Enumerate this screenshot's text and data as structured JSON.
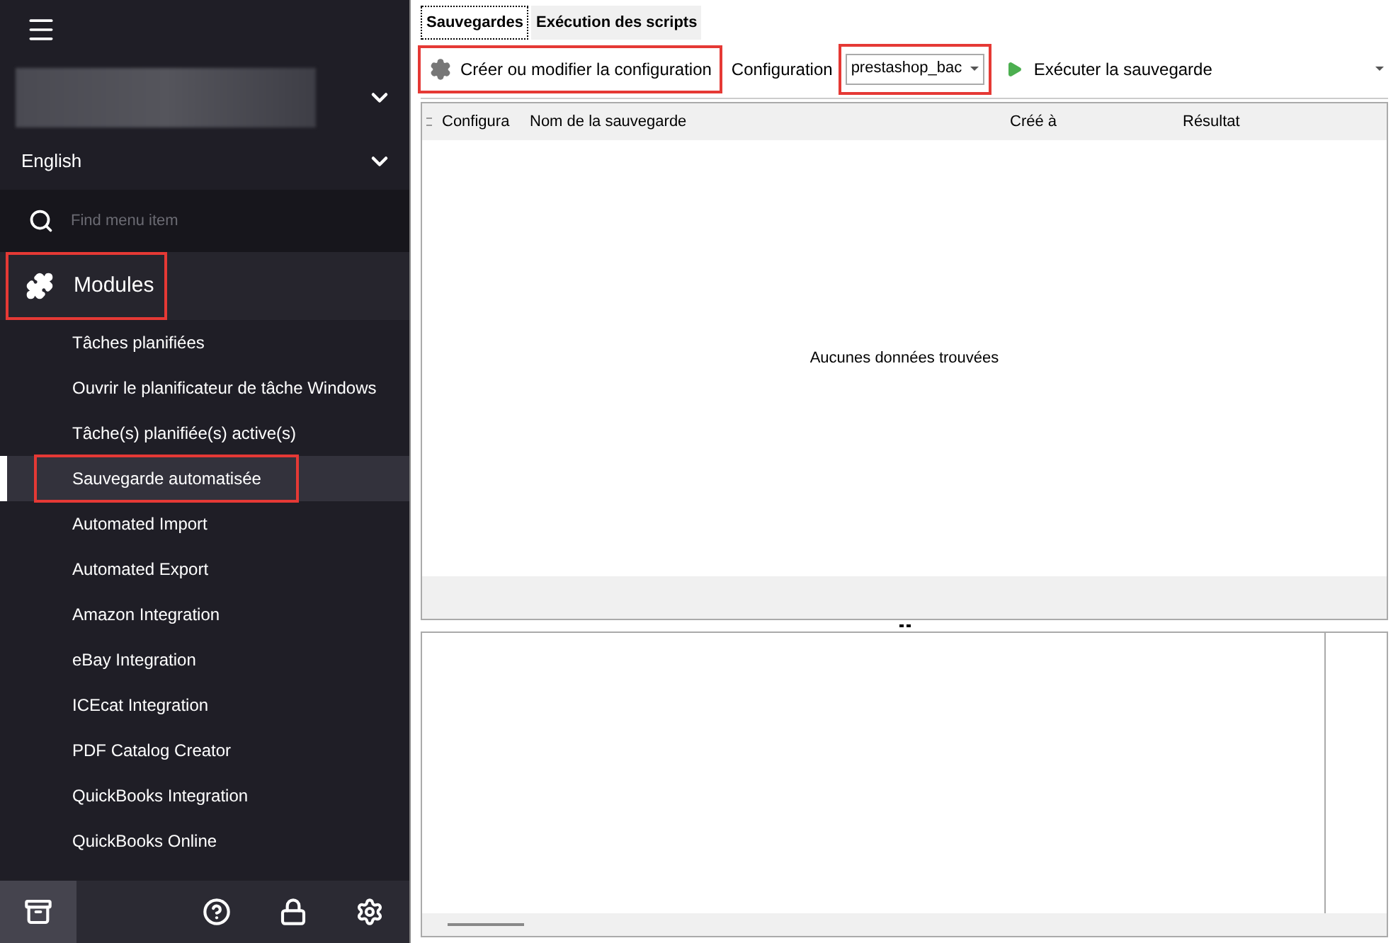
{
  "sidebar": {
    "language": "English",
    "search": {
      "placeholder": "Find menu item"
    },
    "section": {
      "label": "Modules",
      "highlighted": true,
      "expanded": true
    },
    "items": [
      {
        "label": "Tâches planifiées",
        "selected": false,
        "highlighted": false
      },
      {
        "label": "Ouvrir le planificateur de tâche Windows",
        "selected": false,
        "highlighted": false
      },
      {
        "label": "Tâche(s) planifiée(s) active(s)",
        "selected": false,
        "highlighted": false
      },
      {
        "label": "Sauvegarde automatisée",
        "selected": true,
        "highlighted": true
      },
      {
        "label": "Automated Import",
        "selected": false,
        "highlighted": false
      },
      {
        "label": "Automated Export",
        "selected": false,
        "highlighted": false
      },
      {
        "label": "Amazon Integration",
        "selected": false,
        "highlighted": false
      },
      {
        "label": "eBay Integration",
        "selected": false,
        "highlighted": false
      },
      {
        "label": "ICEcat Integration",
        "selected": false,
        "highlighted": false
      },
      {
        "label": "PDF Catalog Creator",
        "selected": false,
        "highlighted": false
      },
      {
        "label": "QuickBooks Integration",
        "selected": false,
        "highlighted": false
      },
      {
        "label": "QuickBooks Online",
        "selected": false,
        "highlighted": false
      }
    ],
    "bottom_buttons": [
      {
        "kind": "archive",
        "selected": true
      },
      {
        "kind": "help",
        "selected": false
      },
      {
        "kind": "lock",
        "selected": false
      },
      {
        "kind": "settings",
        "selected": false
      }
    ]
  },
  "tabs": [
    {
      "label": "Sauvegardes",
      "selected": true
    },
    {
      "label": "Exécution des scripts",
      "selected": false
    }
  ],
  "toolbar": {
    "create_button": {
      "label": "Créer ou modifier la configuration",
      "highlighted": true
    },
    "configuration_label": "Configuration",
    "configuration_value": "prestashop_bac",
    "configuration_highlighted": true,
    "run_button": "Exécuter la sauvegarde"
  },
  "table": {
    "columns": [
      "Configura",
      "Nom de la sauvegarde",
      "Créé à",
      "Résultat"
    ],
    "empty_message": "Aucunes données trouvées"
  }
}
